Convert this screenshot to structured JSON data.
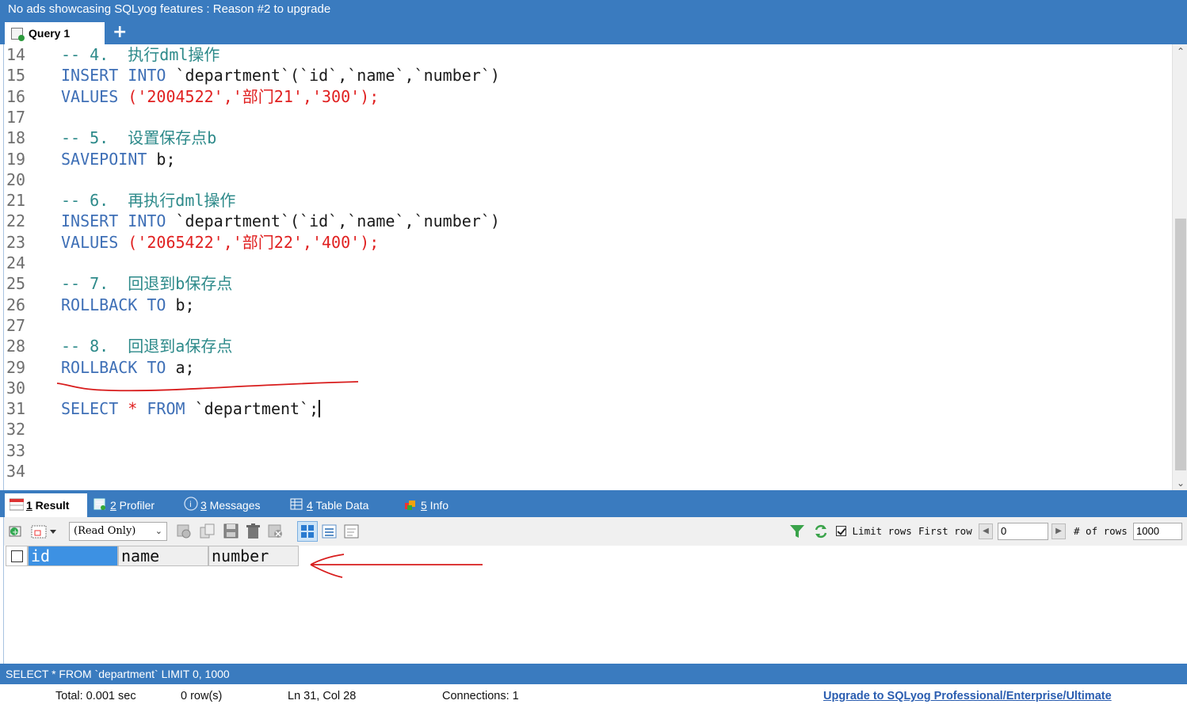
{
  "banner": {
    "text": "No ads showcasing SQLyog features : Reason #2 to upgrade"
  },
  "query_tabs": {
    "active_label": "Query 1",
    "add_label": "+"
  },
  "editor": {
    "lines": [
      {
        "n": "14",
        "parts": [
          {
            "c": "cm",
            "t": "-- 4.  执行dml操作"
          }
        ]
      },
      {
        "n": "15",
        "parts": [
          {
            "c": "kw",
            "t": "INSERT INTO "
          },
          {
            "c": "txt",
            "t": "`department`(`id`,`name`,`number`)"
          }
        ]
      },
      {
        "n": "16",
        "parts": [
          {
            "c": "kw",
            "t": "VALUES "
          },
          {
            "c": "str",
            "t": "('2004522','部门21','300');"
          }
        ]
      },
      {
        "n": "17",
        "parts": []
      },
      {
        "n": "18",
        "parts": [
          {
            "c": "cm",
            "t": "-- 5.  设置保存点b"
          }
        ]
      },
      {
        "n": "19",
        "parts": [
          {
            "c": "kw",
            "t": "SAVEPOINT "
          },
          {
            "c": "txt",
            "t": "b;"
          }
        ]
      },
      {
        "n": "20",
        "parts": []
      },
      {
        "n": "21",
        "parts": [
          {
            "c": "cm",
            "t": "-- 6.  再执行dml操作"
          }
        ]
      },
      {
        "n": "22",
        "parts": [
          {
            "c": "kw",
            "t": "INSERT INTO "
          },
          {
            "c": "txt",
            "t": "`department`(`id`,`name`,`number`)"
          }
        ]
      },
      {
        "n": "23",
        "parts": [
          {
            "c": "kw",
            "t": "VALUES "
          },
          {
            "c": "str",
            "t": "('2065422','部门22','400');"
          }
        ]
      },
      {
        "n": "24",
        "parts": []
      },
      {
        "n": "25",
        "parts": [
          {
            "c": "cm",
            "t": "-- 7.  回退到b保存点"
          }
        ]
      },
      {
        "n": "26",
        "parts": [
          {
            "c": "kw",
            "t": "ROLLBACK TO "
          },
          {
            "c": "txt",
            "t": "b;"
          }
        ]
      },
      {
        "n": "27",
        "parts": []
      },
      {
        "n": "28",
        "parts": [
          {
            "c": "cm",
            "t": "-- 8.  回退到a保存点"
          }
        ]
      },
      {
        "n": "29",
        "parts": [
          {
            "c": "kw",
            "t": "ROLLBACK TO "
          },
          {
            "c": "txt",
            "t": "a;"
          }
        ]
      },
      {
        "n": "30",
        "parts": []
      },
      {
        "n": "31",
        "parts": [
          {
            "c": "kw",
            "t": "SELECT "
          },
          {
            "c": "str",
            "t": "* "
          },
          {
            "c": "kw",
            "t": "FROM "
          },
          {
            "c": "txt",
            "t": "`department`;"
          }
        ],
        "cursor": true
      },
      {
        "n": "32",
        "parts": []
      },
      {
        "n": "33",
        "parts": []
      },
      {
        "n": "34",
        "parts": []
      }
    ]
  },
  "result_tabs": [
    {
      "num": "1",
      "label": " Result",
      "icon": "result-grid-icon"
    },
    {
      "num": "2",
      "label": " Profiler",
      "icon": "profiler-icon"
    },
    {
      "num": "3",
      "label": " Messages",
      "icon": "info-circle-icon"
    },
    {
      "num": "4",
      "label": " Table Data",
      "icon": "table-icon"
    },
    {
      "num": "5",
      "label": " Info",
      "icon": "info-box-icon"
    }
  ],
  "toolbar": {
    "mode_select": "(Read Only)",
    "limit_label": "Limit rows",
    "first_row_label": "First row",
    "first_row_value": "0",
    "rows_label": "# of rows",
    "rows_value": "1000",
    "limit_checked": true
  },
  "grid": {
    "columns": [
      "id",
      "name",
      "number"
    ],
    "selected_column": "id"
  },
  "status": {
    "query": "SELECT * FROM `department` LIMIT 0, 1000",
    "total": "Total: 0.001 sec",
    "rows": "0 row(s)",
    "position": "Ln 31, Col 28",
    "connections": "Connections: 1",
    "upgrade": "Upgrade to SQLyog Professional/Enterprise/Ultimate"
  },
  "colors": {
    "chrome_blue": "#3a7bbf",
    "keyword": "#3e6fb6",
    "comment": "#2d8a8a",
    "string": "#e02020",
    "annotation_red": "#d81c1c",
    "selected_header": "#3d91e3"
  }
}
